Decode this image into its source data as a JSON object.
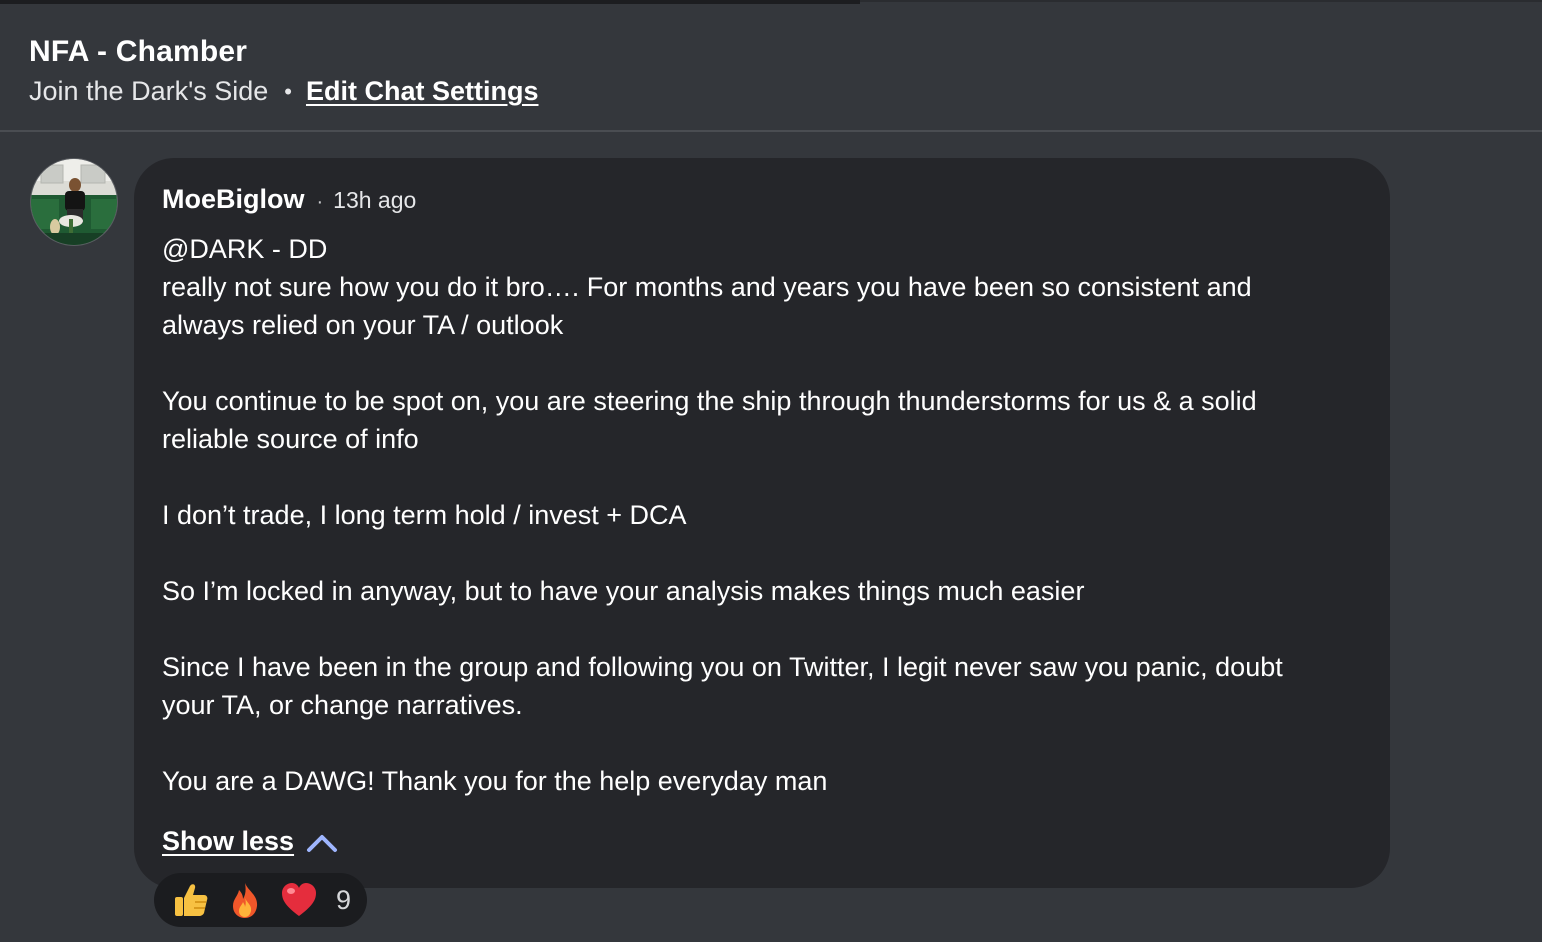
{
  "header": {
    "title": "NFA - Chamber",
    "description": "Join the Dark's Side",
    "separator": "•",
    "edit_settings_link": "Edit Chat Settings"
  },
  "message": {
    "author": "MoeBiglow",
    "separator": "·",
    "time": "13h ago",
    "paragraphs": [
      [
        "@DARK - DD",
        "really not sure how you do it bro…. For months and years you have been so consistent and",
        "always relied on your TA / outlook"
      ],
      [
        "You continue to be spot on, you are steering the ship through thunderstorms for us & a solid",
        "reliable source of info"
      ],
      [
        "I don’t trade, I long term hold / invest + DCA"
      ],
      [
        "So I’m locked in anyway, but to have your analysis makes things much easier"
      ],
      [
        "Since I have been in the group and following you on Twitter, I legit never saw you panic, doubt",
        "your TA, or change narratives."
      ],
      [
        "You are a DAWG! Thank you for the help everyday man"
      ]
    ],
    "show_less_label": "Show less"
  },
  "reactions": {
    "icons": [
      "thumbs-up-icon",
      "fire-icon",
      "heart-icon"
    ],
    "count": "9"
  }
}
